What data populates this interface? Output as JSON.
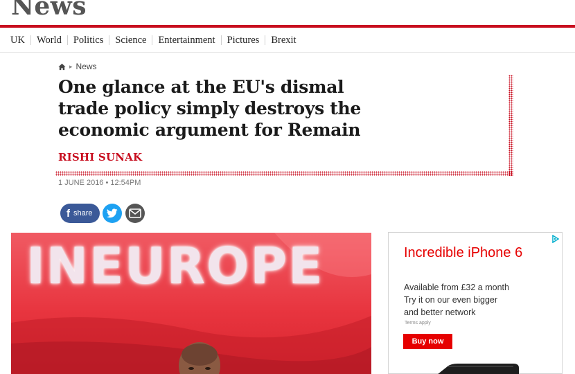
{
  "masthead": {
    "title": "News"
  },
  "nav": {
    "items": [
      {
        "label": "UK"
      },
      {
        "label": "World"
      },
      {
        "label": "Politics"
      },
      {
        "label": "Science"
      },
      {
        "label": "Entertainment"
      },
      {
        "label": "Pictures"
      },
      {
        "label": "Brexit"
      }
    ]
  },
  "breadcrumb": {
    "home_icon": "home-icon",
    "section": "News"
  },
  "article": {
    "headline": "One glance at the EU's dismal trade policy simply destroys the economic argument for Remain",
    "author": "RISHI SUNAK",
    "timestamp": "1 JUNE 2016 • 12:54PM"
  },
  "share": {
    "facebook_label": "share",
    "facebook_icon": "facebook-icon",
    "twitter_icon": "twitter-icon",
    "email_icon": "email-icon"
  },
  "hero": {
    "banner_text": "INEUROPE"
  },
  "ad": {
    "title": "Incredible iPhone 6",
    "line1": "Available from £32 a month",
    "line2": "Try it on our even bigger",
    "line3": "and better network",
    "terms": "Terms apply",
    "button": "Buy now",
    "adchoices_icon": "adchoices-icon"
  },
  "colors": {
    "brand_red": "#c80e1f",
    "facebook": "#3b5998",
    "twitter": "#1da1f2",
    "ad_red": "#e60000"
  }
}
